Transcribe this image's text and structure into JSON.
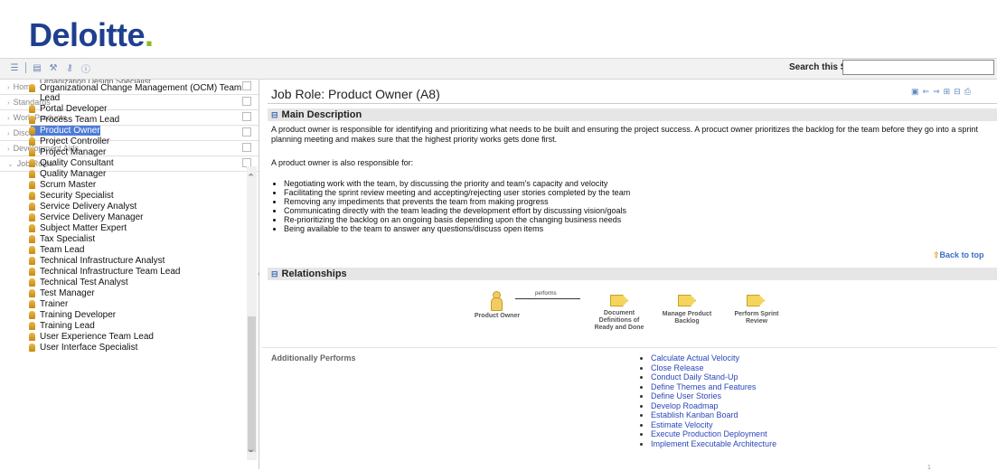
{
  "brand": {
    "name": "Deloitte",
    "dot": "."
  },
  "toolbar": {
    "icons": [
      "list-icon",
      "tree-icon",
      "tools-icon",
      "key-icon",
      "info-icon"
    ]
  },
  "search": {
    "label": "Search this Site:",
    "value": ""
  },
  "nav": {
    "sections": [
      "Home",
      "Standards",
      "Work Products",
      "Disciplines",
      "Development Aids",
      "Job Roles"
    ],
    "cut_item": "Organization Design Specialist",
    "job_roles": [
      "Organizational Change Management (OCM) Team Lead",
      "Portal Developer",
      "Process Team Lead",
      "Product Owner",
      "Project Controller",
      "Project Manager",
      "Quality Consultant",
      "Quality Manager",
      "Scrum Master",
      "Security Specialist",
      "Service Delivery Analyst",
      "Service Delivery Manager",
      "Subject Matter Expert",
      "Tax Specialist",
      "Team Lead",
      "Technical Infrastructure Analyst",
      "Technical Infrastructure Team Lead",
      "Technical Test Analyst",
      "Test Manager",
      "Trainer",
      "Training Developer",
      "Training Lead",
      "User Experience Team Lead",
      "User Interface Specialist"
    ],
    "selected": "Product Owner"
  },
  "page": {
    "title": "Job Role: Product Owner (A8)",
    "main_description": {
      "heading": "Main Description",
      "para1": "A product owner is responsible for identifying and prioritizing what needs to be built and ensuring the project success. A procuct owner prioritizes the backlog for the team before they go into a sprint planning meeting and makes sure that the highest priority works gets done first.",
      "para2": "A product owner is also responsible for:",
      "bullets": [
        "Negotiating work with the team, by discussing the priority and team's capacity and velocity",
        "Facilitating the sprint review meeting and accepting/rejecting user stories completed by the team",
        "Removing any impediments that prevents the team from making progress",
        "Communicating directly with the team leading the development effort by discussing vision/goals",
        "Re-prioritizing the backlog on an ongoing basis depending upon the changing business needs",
        "Being available to the team to answer any questions/discuss open items"
      ]
    },
    "back_to_top": "Back to top",
    "relationships": {
      "heading": "Relationships",
      "actor": "Product Owner",
      "relation": "performs",
      "tasks": [
        "Document Definitions of Ready and Done",
        "Manage Product Backlog",
        "Perform Sprint Review"
      ]
    },
    "additionally_performs": {
      "label": "Additionally Performs",
      "items": [
        "Calculate Actual Velocity",
        "Close Release",
        "Conduct Daily Stand-Up",
        "Define Themes and Features",
        "Define User Stories",
        "Develop Roadmap",
        "Establish Kanban Board",
        "Estimate Velocity",
        "Execute Production Deployment",
        "Implement Executable Architecture"
      ]
    },
    "page_number": "1"
  },
  "colors": {
    "brand_blue": "#1f3f8f",
    "brand_green": "#86bc25",
    "link": "#2b47b8",
    "selection": "#4d7cd6"
  }
}
